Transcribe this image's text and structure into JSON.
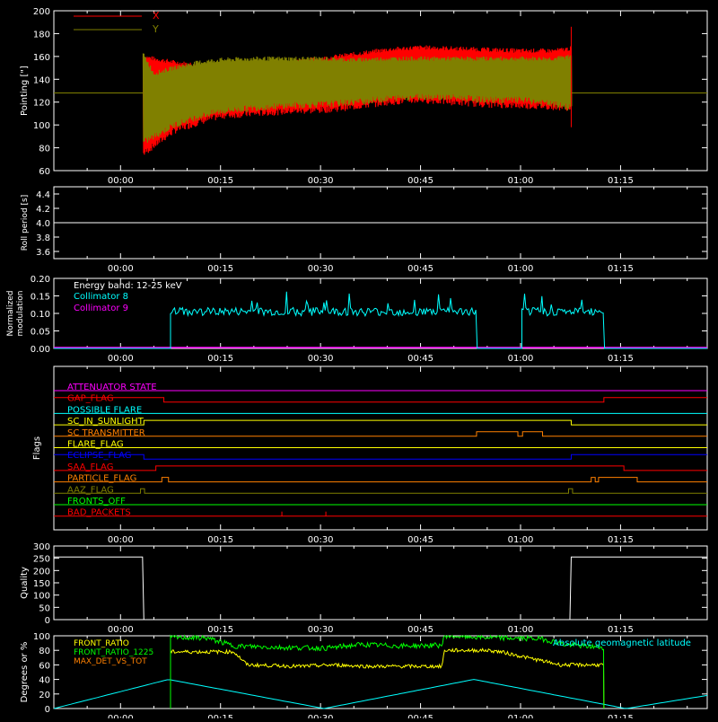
{
  "time_axis": {
    "start_label": "00:00",
    "min": -10,
    "max": 88,
    "ticks": [
      "00:00",
      "00:15",
      "00:30",
      "00:45",
      "01:00",
      "01:15"
    ],
    "tick_values": [
      0,
      15,
      30,
      45,
      60,
      75
    ],
    "minor_step": 5
  },
  "colors": {
    "x_series": "#ff0000",
    "y_series": "#808000",
    "collimator8": "#00ffff",
    "collimator9": "#ff00ff",
    "white": "#ffffff",
    "front_ratio": "#ffff00",
    "front_ratio_1225": "#00ff00",
    "maxdet": "#ff8000",
    "geomag": "#00ffff"
  },
  "chart_data": [
    {
      "type": "area",
      "name": "pointing",
      "ylabel": "Pointing [\"]",
      "ylim": [
        60,
        200
      ],
      "yticks": [
        60,
        80,
        100,
        120,
        140,
        160,
        180,
        200
      ],
      "legend": [
        "X",
        "Y"
      ],
      "reference_level": 128,
      "data_start": 3.4,
      "data_end": 67.6,
      "series": [
        {
          "name": "X",
          "envelope_x": [
            3.4,
            5,
            8,
            12,
            15,
            20,
            25,
            30,
            35,
            40,
            45,
            50,
            55,
            60,
            65,
            67.6
          ],
          "upper": [
            160,
            158,
            155,
            152,
            152,
            153,
            155,
            158,
            162,
            166,
            168,
            167,
            166,
            165,
            165,
            167
          ],
          "lower": [
            75,
            82,
            95,
            103,
            108,
            110,
            112,
            113,
            116,
            120,
            122,
            120,
            118,
            117,
            116,
            115
          ]
        },
        {
          "name": "Y",
          "envelope_x": [
            3.4,
            5,
            8,
            12,
            15,
            20,
            25,
            30,
            35,
            40,
            45,
            50,
            55,
            60,
            65,
            67.6
          ],
          "upper": [
            162,
            145,
            150,
            155,
            157,
            158,
            158,
            158,
            157,
            158,
            158,
            158,
            158,
            158,
            158,
            160
          ],
          "lower": [
            85,
            90,
            100,
            108,
            112,
            115,
            117,
            118,
            120,
            123,
            125,
            124,
            122,
            122,
            118,
            115
          ]
        }
      ]
    },
    {
      "type": "line",
      "name": "roll_period",
      "ylabel": "Roll period [s]",
      "ylim": [
        3.5,
        4.5
      ],
      "yticks": [
        "3.6",
        "3.8",
        "4.0",
        "4.2",
        "4.4"
      ],
      "ytick_values": [
        3.6,
        3.8,
        4.0,
        4.2,
        4.4
      ],
      "series": [
        {
          "name": "",
          "x": [
            -10,
            88
          ],
          "y": [
            4.0,
            4.0
          ]
        }
      ]
    },
    {
      "type": "line",
      "name": "modulation",
      "ylabel_lines": [
        "Normalized",
        "modulation"
      ],
      "ylim": [
        0,
        0.2
      ],
      "yticks": [
        "0.00",
        "0.05",
        "0.10",
        "0.15",
        "0.20"
      ],
      "ytick_values": [
        0,
        0.05,
        0.1,
        0.15,
        0.2
      ],
      "legend": [
        "Energy band: 12-25 keV",
        "Collimator 8",
        "Collimator 9"
      ],
      "segments": [
        [
          7.5,
          53.5
        ],
        [
          60.2,
          72.6
        ]
      ],
      "mean": 0.105,
      "spread": 0.012
    },
    {
      "type": "line",
      "name": "flags",
      "ylabel": "Flags",
      "flags": [
        {
          "label": "ATTENUATOR STATE",
          "color": "#ff00ff",
          "base": 0,
          "steps": []
        },
        {
          "label": "GAP_FLAG",
          "color": "#ff0000",
          "base": 1,
          "steps": [
            [
              6.5,
              0
            ],
            [
              72.5,
              1
            ]
          ]
        },
        {
          "label": "POSSIBLE FLARE",
          "color": "#00ffff",
          "base": 0,
          "steps": []
        },
        {
          "label": "SC_IN_SUNLIGHT",
          "color": "#ffff00",
          "base": 0,
          "steps": [
            [
              3.5,
              1
            ],
            [
              67.6,
              0
            ]
          ]
        },
        {
          "label": "SC TRANSMITTER",
          "color": "#ff8000",
          "base": 0,
          "steps": [
            [
              53.4,
              1
            ],
            [
              59.6,
              0
            ],
            [
              60.3,
              1
            ],
            [
              63.3,
              0
            ]
          ]
        },
        {
          "label": "FLARE_FLAG",
          "color": "#ffff00",
          "base": 0,
          "steps": []
        },
        {
          "label": "ECLIPSE_FLAG",
          "color": "#0000ff",
          "base": 1,
          "steps": [
            [
              3.5,
              0
            ],
            [
              67.6,
              1
            ]
          ]
        },
        {
          "label": "SAA_FLAG",
          "color": "#ff0000",
          "base": 0,
          "steps": [
            [
              5.3,
              1
            ],
            [
              75.5,
              0
            ]
          ]
        },
        {
          "label": "PARTICLE_FLAG",
          "color": "#ff8000",
          "base": 0,
          "steps": [
            [
              6.2,
              1
            ],
            [
              7.2,
              0
            ],
            [
              70.6,
              1
            ],
            [
              71.2,
              0
            ],
            [
              71.7,
              1
            ],
            [
              77.5,
              0
            ]
          ]
        },
        {
          "label": "AAZ_FLAG",
          "color": "#808000",
          "base": 0,
          "steps": [
            [
              3.0,
              1
            ],
            [
              3.6,
              0
            ],
            [
              67.2,
              1
            ],
            [
              67.8,
              0
            ]
          ]
        },
        {
          "label": "FRONTS_OFF",
          "color": "#00ff00",
          "base": 0,
          "steps": []
        },
        {
          "label": "BAD_PACKETS",
          "color": "#ff0000",
          "base": 0,
          "spikes": [
            24.2,
            30.8
          ]
        }
      ]
    },
    {
      "type": "line",
      "name": "quality",
      "ylabel": "Quality",
      "ylim": [
        0,
        300
      ],
      "yticks": [
        "0",
        "50",
        "100",
        "150",
        "200",
        "250",
        "300"
      ],
      "ytick_values": [
        0,
        50,
        100,
        150,
        200,
        250,
        300
      ],
      "series": [
        {
          "name": "",
          "x": [
            -10,
            3.3,
            3.5,
            67.4,
            67.6,
            88
          ],
          "y": [
            255,
            255,
            0,
            0,
            255,
            255
          ]
        }
      ]
    },
    {
      "type": "line",
      "name": "ratios",
      "ylabel": "Degrees or %",
      "ylim": [
        0,
        100
      ],
      "yticks": [
        "0",
        "20",
        "40",
        "60",
        "80",
        "100"
      ],
      "ytick_values": [
        0,
        20,
        40,
        60,
        80,
        100
      ],
      "legend": [
        "FRONT_RATIO",
        "FRONT_RATIO_1225",
        "MAX_DET_VS_TOT"
      ],
      "annotation": "Absolute geomagnetic latitude",
      "geomag_x": [
        -10,
        7.2,
        30.5,
        53.0,
        75.8,
        88
      ],
      "geomag_y": [
        0,
        40,
        0,
        40,
        0,
        18
      ],
      "front_ratio_x": [
        7.5,
        17,
        19,
        23,
        27,
        32,
        37,
        45,
        48.2,
        48.6,
        55,
        57,
        66,
        66.4,
        72.5
      ],
      "front_ratio_y": [
        78,
        78,
        60,
        59,
        58,
        60,
        58,
        58,
        58,
        80,
        80,
        78,
        60,
        60,
        60
      ],
      "front_1225_x": [
        7.5,
        13,
        17,
        24,
        31,
        36,
        42,
        48.2,
        48.6,
        54,
        57,
        63,
        66,
        66.4,
        72.5
      ],
      "front_1225_y": [
        98,
        97,
        86,
        84,
        83,
        88,
        86,
        87,
        100,
        98,
        97,
        96,
        90,
        88,
        84
      ]
    }
  ]
}
